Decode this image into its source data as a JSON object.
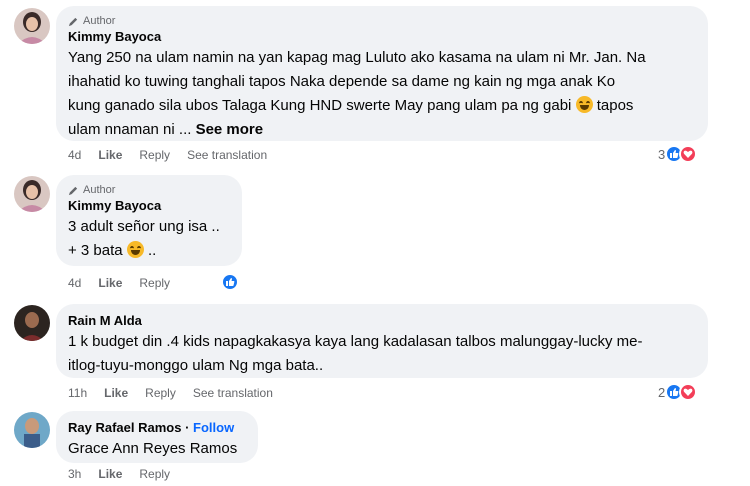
{
  "comments": [
    {
      "badge": "Author",
      "name": "Kimmy Bayoca",
      "lines": [
        "Yang 250 na ulam namin na yan kapag mag Luluto ako kasama na ulam ni Mr. Jan. Na",
        "ihahatid ko tuwing tanghali tapos Naka depende sa dame ng kain ng mga anak Ko",
        "kung ganado sila ubos Talaga Kung HND swerte May pang ulam pa ng gabi",
        "tapos",
        "ulam nnaman ni ...",
        "See more"
      ],
      "time": "4d",
      "like": "Like",
      "reply": "Reply",
      "translate": "See translation",
      "reaction_count": "3"
    },
    {
      "badge": "Author",
      "name": "Kimmy Bayoca",
      "lines": [
        "3 adult señor ung isa ..",
        "+ 3 bata",
        ".."
      ],
      "time": "4d",
      "like": "Like",
      "reply": "Reply"
    },
    {
      "name": "Rain M Alda",
      "lines": [
        "1 k budget din .4 kids napagkakasya kaya lang kadalasan talbos malunggay-lucky me-",
        "itlog-tuyu-monggo ulam Ng mga bata.."
      ],
      "time": "11h",
      "like": "Like",
      "reply": "Reply",
      "translate": "See translation",
      "reaction_count": "2"
    },
    {
      "name": "Ray Rafael Ramos",
      "separator": "·",
      "follow": "Follow",
      "lines": [
        "Grace Ann Reyes Ramos"
      ],
      "time": "3h",
      "like": "Like",
      "reply": "Reply"
    }
  ],
  "icons": {
    "author_badge": "pencil-icon",
    "like_reaction": "thumbs-up-icon",
    "love_reaction": "heart-icon",
    "emoji": "laughing-tears-emoji"
  },
  "colors": {
    "bubble": "#f0f2f5",
    "like_blue": "#1877f2",
    "love_red": "#f33e58",
    "follow_blue": "#0866ff",
    "meta_gray": "#65676b"
  }
}
